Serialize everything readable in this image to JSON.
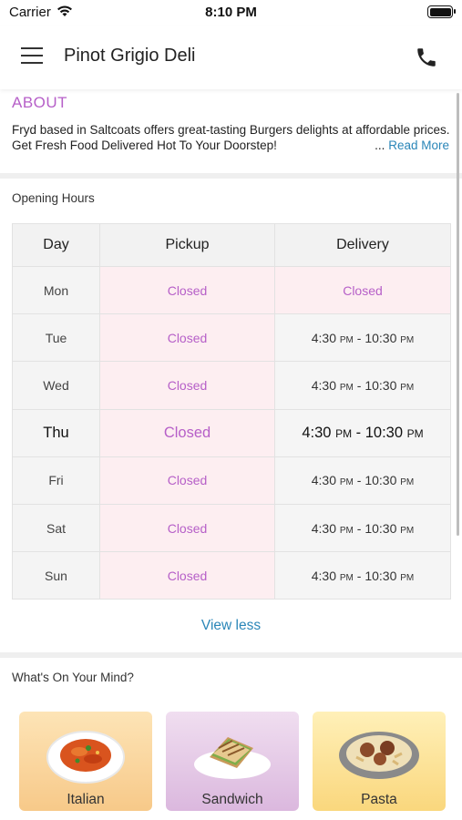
{
  "status_bar": {
    "carrier": "Carrier",
    "time": "8:10 PM"
  },
  "header": {
    "title": "Pinot Grigio Deli"
  },
  "about": {
    "heading": "ABOUT",
    "text": "Fryd based in Saltcoats offers great-tasting Burgers delights at affordable prices. Get Fresh Food Delivered Hot To Your Doorstep!",
    "ellipsis": "...",
    "read_more": "Read More"
  },
  "opening_hours": {
    "title": "Opening Hours",
    "columns": [
      "Day",
      "Pickup",
      "Delivery"
    ],
    "rows": [
      {
        "day": "Mon",
        "pickup": "Closed",
        "delivery": "Closed"
      },
      {
        "day": "Tue",
        "pickup": "Closed",
        "delivery_start": "4:30",
        "delivery_start_ampm": "PM",
        "delivery_sep": " - ",
        "delivery_end": "10:30",
        "delivery_end_ampm": "PM"
      },
      {
        "day": "Wed",
        "pickup": "Closed",
        "delivery_start": "4:30",
        "delivery_start_ampm": "PM",
        "delivery_sep": " - ",
        "delivery_end": "10:30",
        "delivery_end_ampm": "PM"
      },
      {
        "day": "Thu",
        "pickup": "Closed",
        "delivery_start": "4:30",
        "delivery_start_ampm": "PM",
        "delivery_sep": " - ",
        "delivery_end": "10:30",
        "delivery_end_ampm": "PM"
      },
      {
        "day": "Fri",
        "pickup": "Closed",
        "delivery_start": "4:30",
        "delivery_start_ampm": "PM",
        "delivery_sep": " - ",
        "delivery_end": "10:30",
        "delivery_end_ampm": "PM"
      },
      {
        "day": "Sat",
        "pickup": "Closed",
        "delivery_start": "4:30",
        "delivery_start_ampm": "PM",
        "delivery_sep": " - ",
        "delivery_end": "10:30",
        "delivery_end_ampm": "PM"
      },
      {
        "day": "Sun",
        "pickup": "Closed",
        "delivery_start": "4:30",
        "delivery_start_ampm": "PM",
        "delivery_sep": " - ",
        "delivery_end": "10:30",
        "delivery_end_ampm": "PM"
      }
    ],
    "view_less": "View less"
  },
  "categories": {
    "title": "What's On Your Mind?",
    "items": [
      {
        "label": "Italian",
        "icon": "pasta-plate-icon"
      },
      {
        "label": "Sandwich",
        "icon": "sandwich-icon"
      },
      {
        "label": "Pasta",
        "icon": "meatball-pasta-icon"
      }
    ]
  },
  "colors": {
    "accent": "#b65fc8",
    "link": "#2a86b8",
    "closed_bg": "#fdeef1",
    "header_bg": "#f2f2f2"
  }
}
